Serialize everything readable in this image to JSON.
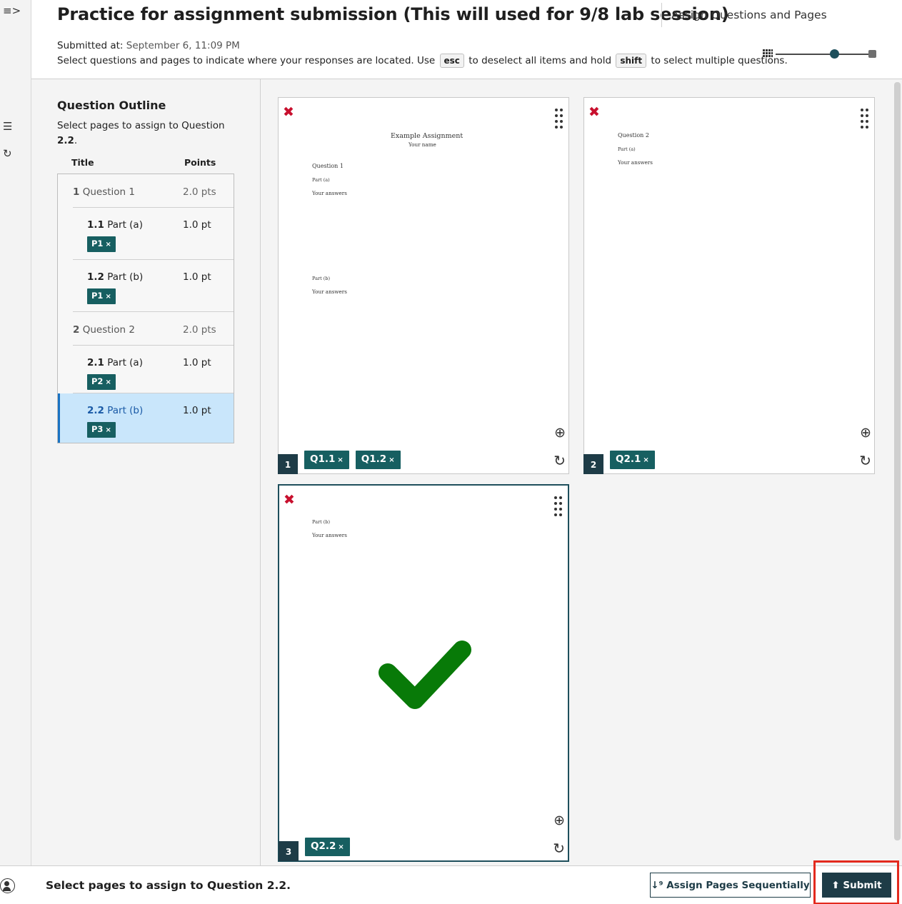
{
  "rail": {
    "expand_icon": "≡>",
    "outline_icon": "☰",
    "refresh_icon": "↻"
  },
  "header": {
    "title": "Practice for assignment submission (This will used for 9/8 lab session)",
    "breadcrumb": "Assign Questions and Pages",
    "submitted_label": "Submitted at:",
    "submitted_value": "September 6, 11:09 PM",
    "instructions": {
      "part1": "Select questions and pages to indicate where your responses are located. Use",
      "key1": "esc",
      "part2": "to deselect all items and hold",
      "key2": "shift",
      "part3": "to select multiple questions."
    }
  },
  "outline": {
    "title": "Question Outline",
    "subtitle_prefix": "Select pages to assign to Question",
    "subtitle_question": "2.2",
    "subtitle_suffix": ".",
    "col_title": "Title",
    "col_points": "Points",
    "questions": [
      {
        "num": "1",
        "name": "Question 1",
        "points": "2.0 pts",
        "parts": [
          {
            "num": "1.1",
            "name": "Part (a)",
            "points": "1.0 pt",
            "tag": "P1"
          },
          {
            "num": "1.2",
            "name": "Part (b)",
            "points": "1.0 pt",
            "tag": "P1"
          }
        ]
      },
      {
        "num": "2",
        "name": "Question 2",
        "points": "2.0 pts",
        "parts": [
          {
            "num": "2.1",
            "name": "Part (a)",
            "points": "1.0 pt",
            "tag": "P2"
          },
          {
            "num": "2.2",
            "name": "Part (b)",
            "points": "1.0 pt",
            "tag": "P3"
          }
        ]
      }
    ]
  },
  "pages": [
    {
      "number": "1",
      "tags": [
        "Q1.1",
        "Q1.2"
      ],
      "doc": {
        "heading": "Example Assignment",
        "subheading": "Your name",
        "q_title": "Question 1",
        "part_a": "Part (a)",
        "answers_a": "Your answers",
        "part_b": "Part (b)",
        "answers_b": "Your answers"
      }
    },
    {
      "number": "2",
      "tags": [
        "Q2.1"
      ],
      "doc": {
        "q_title": "Question 2",
        "part_a": "Part (a)",
        "answers_a": "Your answers"
      }
    },
    {
      "number": "3",
      "tags": [
        "Q2.2"
      ],
      "doc": {
        "part_b": "Part (b)",
        "answers_b": "Your answers"
      }
    }
  ],
  "icons": {
    "delete": "✖",
    "zoom": "⊕",
    "rotate": "↻",
    "tag_remove": "×",
    "checkmark_color": "#087a08"
  },
  "footer": {
    "message": "Select pages to assign to Question 2.2.",
    "assign_sequentially_label": "Assign Pages Sequentially",
    "submit_label": "Submit"
  },
  "colors": {
    "tag_bg": "#175f61",
    "primary_dark": "#1e3c47",
    "selected_row_bg": "#c9e6fb",
    "delete_red": "#c8102e",
    "highlight_frame": "#e32a1e"
  }
}
